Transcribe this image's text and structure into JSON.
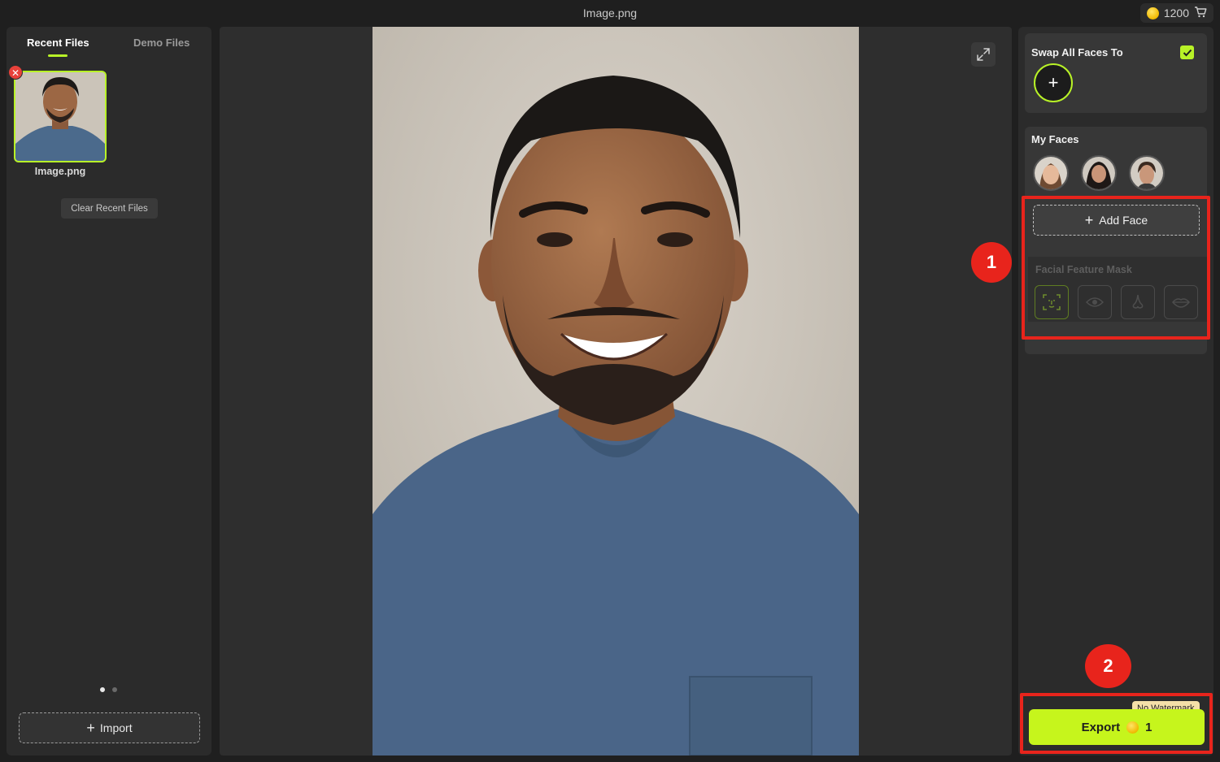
{
  "window": {
    "title": "Image.png"
  },
  "credits": {
    "balance": "1200",
    "coin_icon": "coin-icon",
    "cart_icon": "cart-icon"
  },
  "left_panel": {
    "tabs": [
      {
        "label": "Recent Files",
        "active": true
      },
      {
        "label": "Demo Files",
        "active": false
      }
    ],
    "recent_files": [
      {
        "name": "Image.png",
        "selected": true
      }
    ],
    "clear_label": "Clear Recent Files",
    "pagination": {
      "pages": 2,
      "current": 1
    },
    "import_label": "Import"
  },
  "right_panel": {
    "swap_all": {
      "title": "Swap All Faces To",
      "checked": true
    },
    "my_faces": {
      "title": "My Faces",
      "count": 3
    },
    "add_face_label": "Add Face",
    "facial_mask": {
      "title": "Facial Feature Mask",
      "options": [
        "face-scan-icon",
        "eye-icon",
        "nose-icon",
        "lips-icon"
      ],
      "active_index": 0
    },
    "export": {
      "label": "Export",
      "cost": "1",
      "badge": "No Watermark"
    }
  },
  "annotations": {
    "marker_1": "1",
    "marker_2": "2"
  },
  "colors": {
    "accent": "#b8f227",
    "export_bg": "#c6f51c",
    "annotation_red": "#e8241c"
  }
}
